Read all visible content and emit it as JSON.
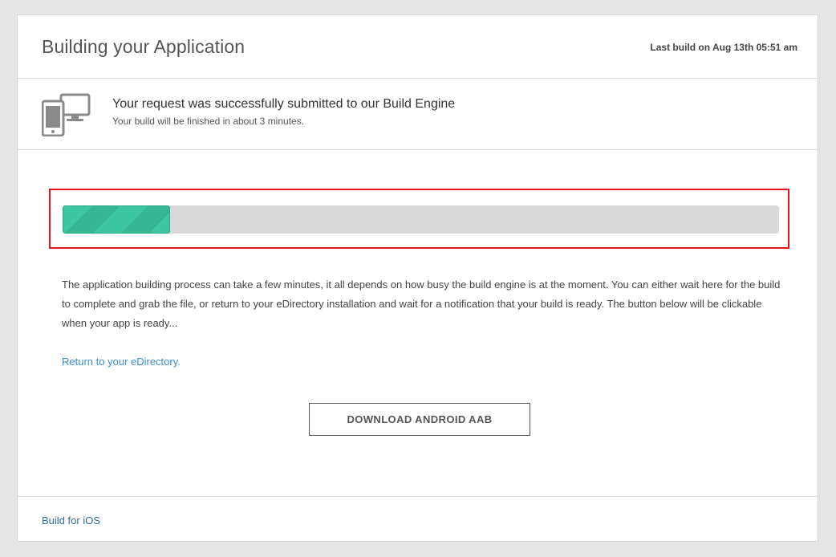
{
  "header": {
    "title": "Building your Application",
    "last_build": "Last build on Aug 13th 05:51 am"
  },
  "status": {
    "icon": "devices-icon",
    "title": "Your request was successfully submitted to our Build Engine",
    "subtitle": "Your build will be finished in about 3 minutes."
  },
  "progress": {
    "percent": 15,
    "color": "#3cc6a1",
    "highlight_color": "#e5121d"
  },
  "main": {
    "description": "The application building process can take a few minutes, it all depends on how busy the build engine is at the moment. You can either wait here for the build to complete and grab the file, or return to your eDirectory installation and wait for a notification that your build is ready. The button below will be clickable when your app is ready...",
    "return_link": "Return to your eDirectory.",
    "download_label": "DOWNLOAD ANDROID AAB"
  },
  "footer": {
    "ios_link": "Build for iOS"
  }
}
